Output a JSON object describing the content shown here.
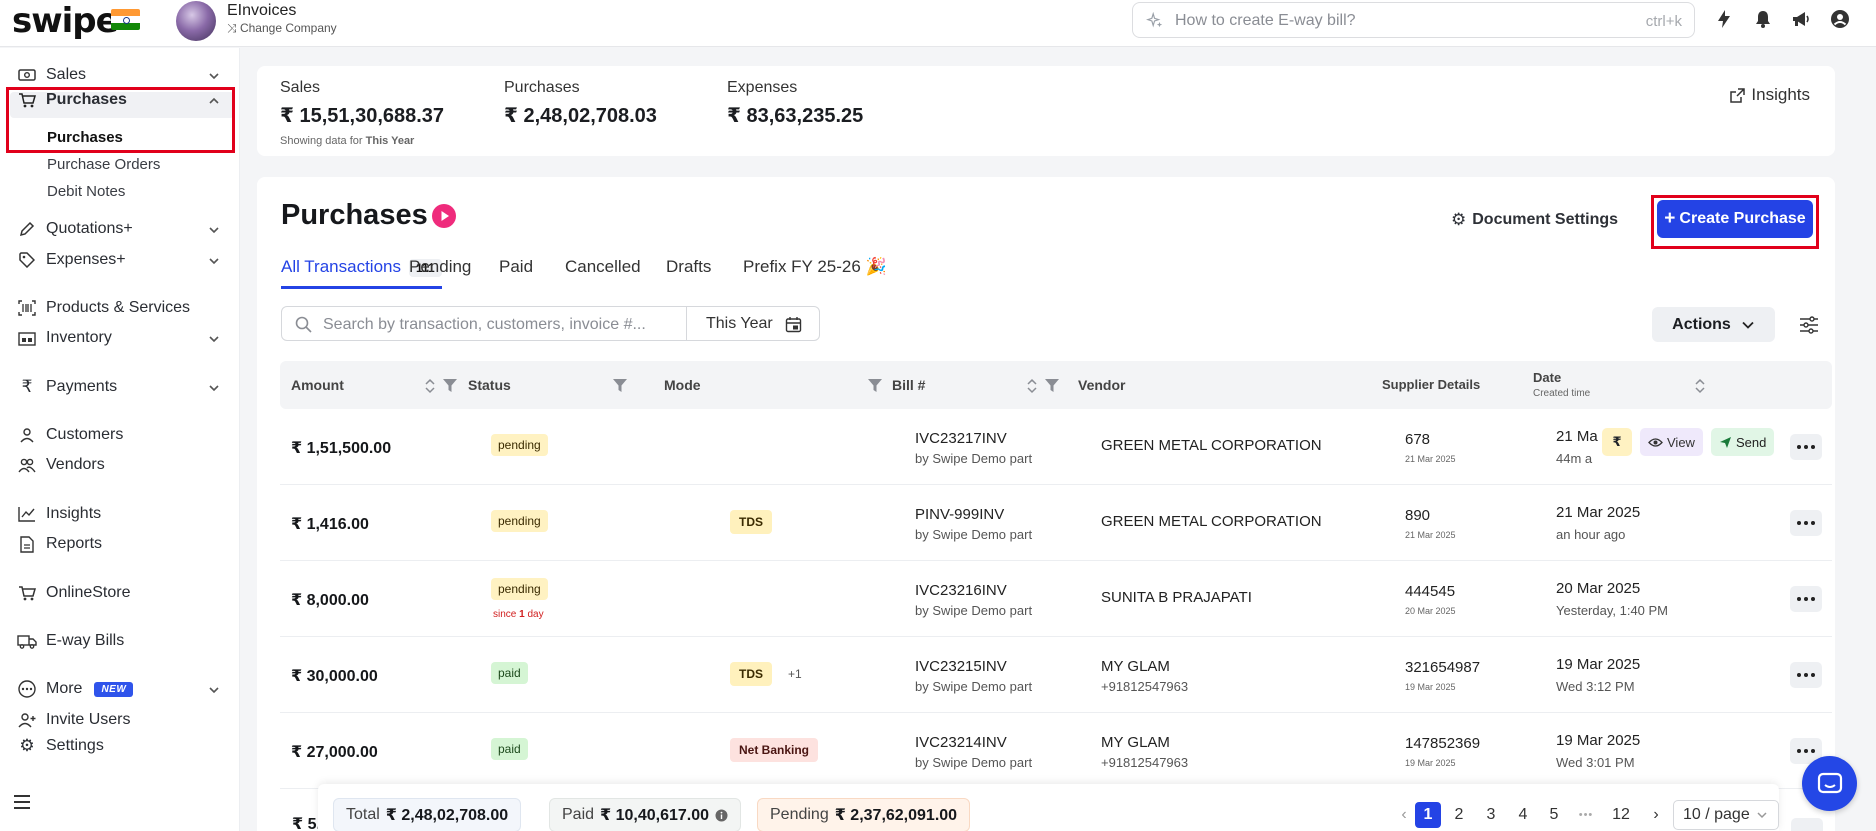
{
  "app": {
    "logo": "swipe",
    "company_name": "EInvoices",
    "change_company": "Change Company",
    "search_placeholder": "How to create E-way bill?",
    "search_shortcut": "ctrl+k"
  },
  "sidebar": {
    "sales": "Sales",
    "purchases": "Purchases",
    "purchases_sub": [
      "Purchases",
      "Purchase Orders",
      "Debit Notes"
    ],
    "quotations": "Quotations+",
    "expenses": "Expenses+",
    "products": "Products & Services",
    "inventory": "Inventory",
    "payments": "Payments",
    "customers": "Customers",
    "vendors": "Vendors",
    "insights": "Insights",
    "reports": "Reports",
    "online_store": "OnlineStore",
    "eway": "E-way Bills",
    "more": "More",
    "more_badge": "NEW",
    "invite": "Invite Users",
    "settings": "Settings"
  },
  "summary": {
    "sales_label": "Sales",
    "sales_value": "₹ 15,51,30,688.37",
    "purchases_label": "Purchases",
    "purchases_value": "₹ 2,48,02,708.03",
    "expenses_label": "Expenses",
    "expenses_value": "₹ 83,63,235.25",
    "note_prefix": "Showing data for",
    "note_period": "This Year",
    "insights_link": "Insights"
  },
  "main": {
    "title": "Purchases",
    "doc_settings": "Document Settings",
    "create_button": "Create Purchase",
    "tabs": [
      {
        "label": "All Transactions",
        "count": "111"
      },
      {
        "label": "Pending"
      },
      {
        "label": "Paid"
      },
      {
        "label": "Cancelled"
      },
      {
        "label": "Drafts"
      },
      {
        "label": "Prefix FY 25-26 🎉"
      }
    ],
    "search_placeholder": "Search by transaction, customers, invoice #...",
    "period": "This Year",
    "actions": "Actions"
  },
  "table": {
    "headers": {
      "amount": "Amount",
      "status": "Status",
      "mode": "Mode",
      "bill": "Bill #",
      "vendor": "Vendor",
      "supplier": "Supplier Details",
      "date": "Date",
      "date_sub": "Created time"
    },
    "rows": [
      {
        "amount": "₹ 1,51,500.00",
        "status": "pending",
        "bill": "IVC23217INV",
        "by": "by Swipe Demo part",
        "vendor": "GREEN METAL CORPORATION",
        "supplier": "678",
        "supplier_date": "21 Mar 2025",
        "date": "21 Ma",
        "date_sub": "44m a"
      },
      {
        "amount": "₹ 1,416.00",
        "status": "pending",
        "mode": "TDS",
        "bill": "PINV-999INV",
        "by": "by Swipe Demo part",
        "vendor": "GREEN METAL CORPORATION",
        "supplier": "890",
        "supplier_date": "21 Mar 2025",
        "date": "21 Mar 2025",
        "date_sub": "an hour ago"
      },
      {
        "amount": "₹ 8,000.00",
        "status": "pending",
        "since_prefix": "since",
        "since_num": "1",
        "since_suffix": "day",
        "bill": "IVC23216INV",
        "by": "by Swipe Demo part",
        "vendor": "SUNITA B PRAJAPATI",
        "supplier": "444545",
        "supplier_date": "20 Mar 2025",
        "date": "20 Mar 2025",
        "date_sub": "Yesterday, 1:40 PM"
      },
      {
        "amount": "₹ 30,000.00",
        "status": "paid",
        "mode": "TDS",
        "mode_extra": "+1",
        "bill": "IVC23215INV",
        "by": "by Swipe Demo part",
        "vendor": "MY GLAM",
        "phone": "+91812547963",
        "supplier": "321654987",
        "supplier_date": "19 Mar 2025",
        "date": "19 Mar 2025",
        "date_sub": "Wed 3:12 PM"
      },
      {
        "amount": "₹ 27,000.00",
        "status": "paid",
        "mode": "Net Banking",
        "bill": "IVC23214INV",
        "by": "by Swipe Demo part",
        "vendor": "MY GLAM",
        "phone": "+91812547963",
        "supplier": "147852369",
        "supplier_date": "19 Mar 2025",
        "date": "19 Mar 2025",
        "date_sub": "Wed 3:01 PM"
      }
    ],
    "peek_amount": "₹ 5,",
    "row_actions": {
      "rupee": "₹",
      "view": "View",
      "send": "Send"
    }
  },
  "footer": {
    "total_label": "Total",
    "total_value": "₹ 2,48,02,708.00",
    "paid_label": "Paid",
    "paid_value": "₹ 10,40,617.00",
    "pending_label": "Pending",
    "pending_value": "₹ 2,37,62,091.00",
    "pages": [
      "1",
      "2",
      "3",
      "4",
      "5"
    ],
    "ellipsis": "•••",
    "last_page": "12",
    "prev": "‹",
    "next": "›",
    "per_page": "10 / page"
  },
  "colors": {
    "primary": "#2443e5",
    "highlight": "#e1001b",
    "accent_pink": "#ef2b7c"
  }
}
